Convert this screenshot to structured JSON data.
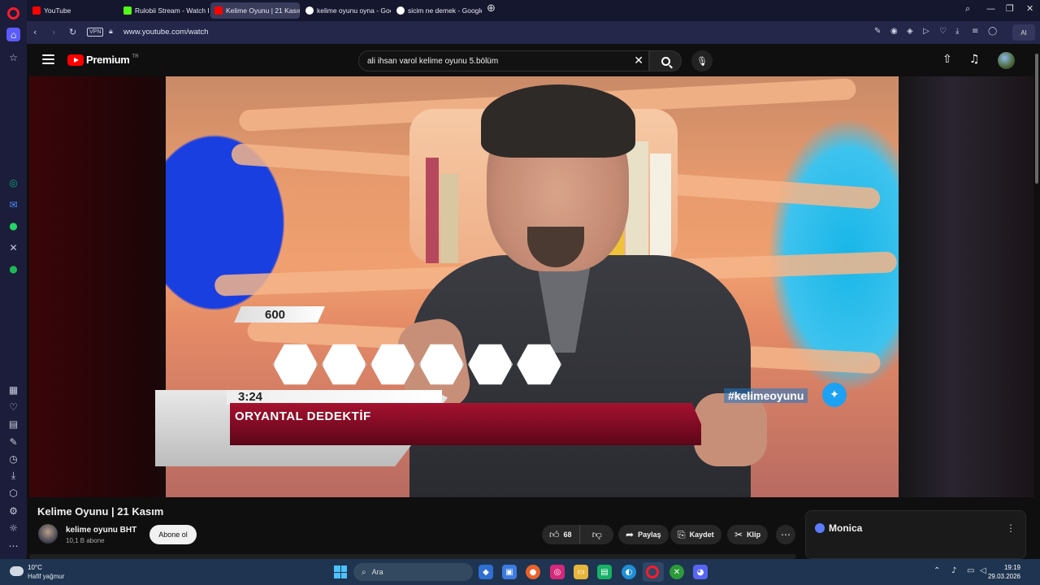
{
  "browser": {
    "tabs": [
      {
        "label": "YouTube",
        "favicon_color": "#ff0000"
      },
      {
        "label": "Rulobii Stream - Watch Li",
        "favicon_color": "#53fc18"
      },
      {
        "label": "Kelime Oyunu | 21 Kasım",
        "favicon_color": "#ff0000"
      },
      {
        "label": "kelime oyunu oyna - Goo",
        "favicon_color": "#ffffff"
      },
      {
        "label": "sicim ne demek - Google",
        "favicon_color": "#ffffff"
      }
    ],
    "vpn_label": "VPN",
    "url": "www.youtube.com/watch",
    "ai_label": "AI"
  },
  "youtube": {
    "brand": "Premium",
    "region": "TR",
    "search_query": "ali ihsan varol kelime oyunu 5.bölüm",
    "video": {
      "score": "600",
      "timer": "3:24",
      "answer": "ORYANTAL DEDEKTİF",
      "hashtag": "#kelimeoyunu"
    },
    "title": "Kelime Oyunu | 21 Kasım",
    "channel": {
      "name": "kelime oyunu BHT",
      "subscribers": "10,1 B abone",
      "subscribe_label": "Abone ol"
    },
    "actions": {
      "likes": "68",
      "share": "Paylaş",
      "save": "Kaydet",
      "clip": "Klip"
    },
    "monica": {
      "title": "Monica"
    }
  },
  "taskbar": {
    "temperature": "10°C",
    "weather": "Hafif yağmur",
    "search_placeholder": "Ara",
    "time": "19:19",
    "date": "29.03.2026"
  },
  "colors": {
    "accent": "#ff0000",
    "answer_bar": "#8a0c26",
    "opera_red": "#ff1b2d"
  }
}
